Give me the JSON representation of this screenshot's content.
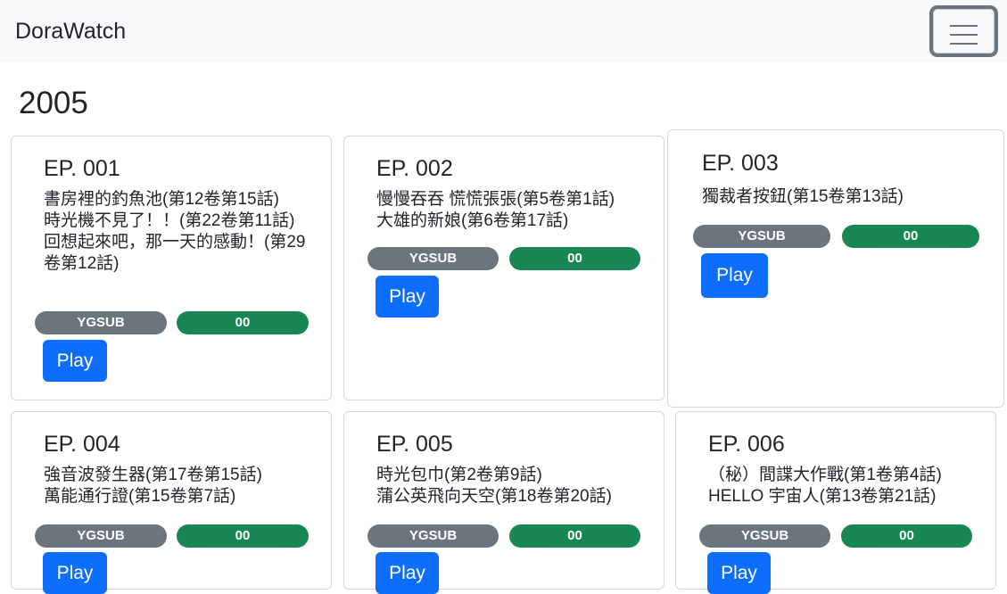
{
  "navbar": {
    "brand": "DoraWatch",
    "toggler_icon": "hamburger-icon"
  },
  "section": {
    "year": "2005"
  },
  "episodes": [
    {
      "ep": "EP. 001",
      "titles": [
        "書房裡的釣魚池(第12卷第15話)",
        "時光機不見了！！(第22卷第11話)",
        "回想起來吧，那一天的感動！(第29卷第12話)"
      ],
      "sub": "YGSUB",
      "num": "00",
      "play": "Play"
    },
    {
      "ep": "EP. 002",
      "titles": [
        "慢慢吞吞 慌慌張張(第5卷第1話)",
        "大雄的新娘(第6卷第17話)"
      ],
      "sub": "YGSUB",
      "num": "00",
      "play": "Play"
    },
    {
      "ep": "EP. 003",
      "titles": [
        "獨裁者按鈕(第15卷第13話)"
      ],
      "sub": "YGSUB",
      "num": "00",
      "play": "Play"
    },
    {
      "ep": "EP. 004",
      "titles": [
        "強音波發生器(第17卷第15話)",
        "萬能通行證(第15卷第7話)"
      ],
      "sub": "YGSUB",
      "num": "00",
      "play": "Play"
    },
    {
      "ep": "EP. 005",
      "titles": [
        "時光包巾(第2卷第9話)",
        "蒲公英飛向天空(第18卷第20話)"
      ],
      "sub": "YGSUB",
      "num": "00",
      "play": "Play"
    },
    {
      "ep": "EP. 006",
      "titles": [
        "（秘）間諜大作戰(第1卷第4話)",
        "HELLO 宇宙人(第13卷第21話)"
      ],
      "sub": "YGSUB",
      "num": "00",
      "play": "Play"
    }
  ],
  "colors": {
    "navbar_bg": "#f8f9fa",
    "badge_sub": "#6c757d",
    "badge_num": "#198754",
    "play_button": "#0d6efd"
  }
}
